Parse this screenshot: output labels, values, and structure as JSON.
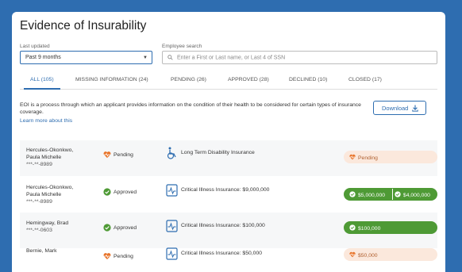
{
  "page_title": "Evidence of Insurability",
  "filters": {
    "last_updated_label": "Last updated",
    "last_updated_value": "Past 9 months",
    "employee_search_label": "Employee search",
    "employee_search_placeholder": "Enter a First or Last name, or Last 4 of SSN"
  },
  "tabs": [
    {
      "label": "ALL (105)",
      "active": true
    },
    {
      "label": "MISSING INFORMATION (24)"
    },
    {
      "label": "PENDING (26)"
    },
    {
      "label": "APPROVED (28)"
    },
    {
      "label": "DECLINED (10)"
    },
    {
      "label": "CLOSED (17)"
    }
  ],
  "description": "EOI is a process through which an applicant provides information on the condition of their health to be considered for certain types of insurance coverage.",
  "learn_more": "Learn more about this",
  "download_label": "Download",
  "colors": {
    "brand": "#2e6db0",
    "approved": "#4e9a35",
    "pending": "#e8742a",
    "pending_bg": "#fbe8dc"
  },
  "rows": [
    {
      "name_line1": "Hercules-Okonkwo,",
      "name_line2": "Paula Michelle",
      "ssn": "***-**-8989",
      "status": "Pending",
      "status_icon": "heart-pulse-icon",
      "product": "Long Term Disability Insurance",
      "product_icon": "wheelchair-icon",
      "pill_label": "Pending"
    },
    {
      "name_line1": "Hercules-Okonkwo,",
      "name_line2": "Paula Michelle",
      "ssn": "***-**-8989",
      "status": "Approved",
      "status_icon": "check-circle-icon",
      "product": "Critical Illness Insurance: $9,000,000",
      "product_icon": "ecg-monitor-icon",
      "pill_amount_1": "$5,000,000",
      "pill_amount_2": "$4,000,000"
    },
    {
      "name_line1": "Hemingway, Brad",
      "ssn": "***-**-0603",
      "status": "Approved",
      "status_icon": "check-circle-icon",
      "product": "Critical Illness Insurance: $100,000",
      "product_icon": "ecg-monitor-icon",
      "pill_amount": "$100,000"
    },
    {
      "name_line1": "Bernie, Mark",
      "status": "Pending",
      "status_icon": "heart-pulse-icon",
      "product": "Critical Illness Insurance: $50,000",
      "product_icon": "ecg-monitor-icon",
      "pill_amount": "$50,000"
    }
  ]
}
